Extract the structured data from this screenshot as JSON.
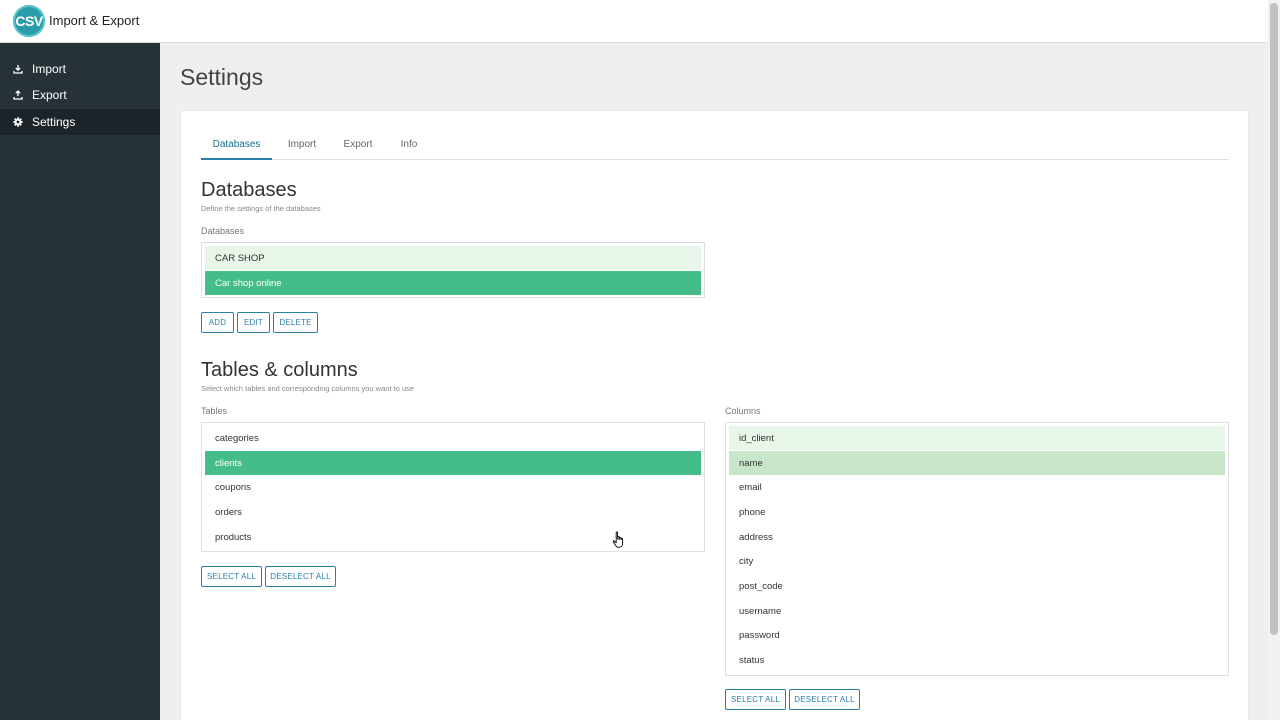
{
  "app": {
    "logo_text": "CSV",
    "title": "Import & Export"
  },
  "sidebar": {
    "items": [
      {
        "label": "Import",
        "icon": "download-icon"
      },
      {
        "label": "Export",
        "icon": "upload-icon"
      },
      {
        "label": "Settings",
        "icon": "gear-icon",
        "active": true
      }
    ]
  },
  "page": {
    "title": "Settings"
  },
  "tabs": [
    {
      "label": "Databases",
      "active": true
    },
    {
      "label": "Import"
    },
    {
      "label": "Export"
    },
    {
      "label": "Info"
    }
  ],
  "databases": {
    "title": "Databases",
    "description": "Define the settings of the databases",
    "list_label": "Databases",
    "items": [
      "CAR SHOP",
      "Car shop online"
    ],
    "buttons": {
      "add": "ADD",
      "edit": "EDIT",
      "delete": "DELETE"
    }
  },
  "tables_columns": {
    "title": "Tables & columns",
    "description": "Select which tables and corresponding columns you want to use",
    "tables_label": "Tables",
    "tables": [
      "categories",
      "clients",
      "coupons",
      "orders",
      "products"
    ],
    "columns_label": "Columns",
    "columns": [
      "id_client",
      "name",
      "email",
      "phone",
      "address",
      "city",
      "post_code",
      "username",
      "password",
      "status"
    ],
    "buttons": {
      "select_all": "SELECT ALL",
      "deselect_all": "DESELECT ALL"
    }
  },
  "colors": {
    "sidebar_bg": "#263238",
    "accent": "#2a7fa6",
    "selected_row": "#44bd8a",
    "highlight_row": "#e8f5e9"
  }
}
